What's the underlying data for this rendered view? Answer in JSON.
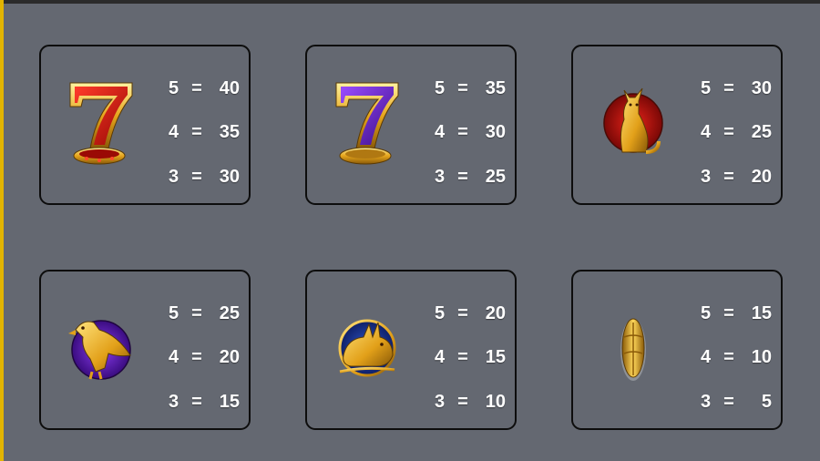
{
  "paytable": [
    {
      "symbol": "red-seven-icon",
      "rows": [
        {
          "count": "5",
          "eq": "=",
          "value": "40"
        },
        {
          "count": "4",
          "eq": "=",
          "value": "35"
        },
        {
          "count": "3",
          "eq": "=",
          "value": "30"
        }
      ]
    },
    {
      "symbol": "purple-seven-icon",
      "rows": [
        {
          "count": "5",
          "eq": "=",
          "value": "35"
        },
        {
          "count": "4",
          "eq": "=",
          "value": "30"
        },
        {
          "count": "3",
          "eq": "=",
          "value": "25"
        }
      ]
    },
    {
      "symbol": "cat-icon",
      "rows": [
        {
          "count": "5",
          "eq": "=",
          "value": "30"
        },
        {
          "count": "4",
          "eq": "=",
          "value": "25"
        },
        {
          "count": "3",
          "eq": "=",
          "value": "20"
        }
      ]
    },
    {
      "symbol": "falcon-icon",
      "rows": [
        {
          "count": "5",
          "eq": "=",
          "value": "25"
        },
        {
          "count": "4",
          "eq": "=",
          "value": "20"
        },
        {
          "count": "3",
          "eq": "=",
          "value": "15"
        }
      ]
    },
    {
      "symbol": "rabbit-icon",
      "rows": [
        {
          "count": "5",
          "eq": "=",
          "value": "20"
        },
        {
          "count": "4",
          "eq": "=",
          "value": "15"
        },
        {
          "count": "3",
          "eq": "=",
          "value": "10"
        }
      ]
    },
    {
      "symbol": "scarab-icon",
      "rows": [
        {
          "count": "5",
          "eq": "=",
          "value": "15"
        },
        {
          "count": "4",
          "eq": "=",
          "value": "10"
        },
        {
          "count": "3",
          "eq": "=",
          "value": "5"
        }
      ]
    }
  ],
  "colors": {
    "background": "#646871",
    "card_border": "#0d0d0d",
    "accent": "#e2b400",
    "text": "#ffffff",
    "gold": "#f0b420",
    "red": "#c8150f",
    "purple": "#6f2bd0",
    "blue": "#1f3fa5"
  }
}
